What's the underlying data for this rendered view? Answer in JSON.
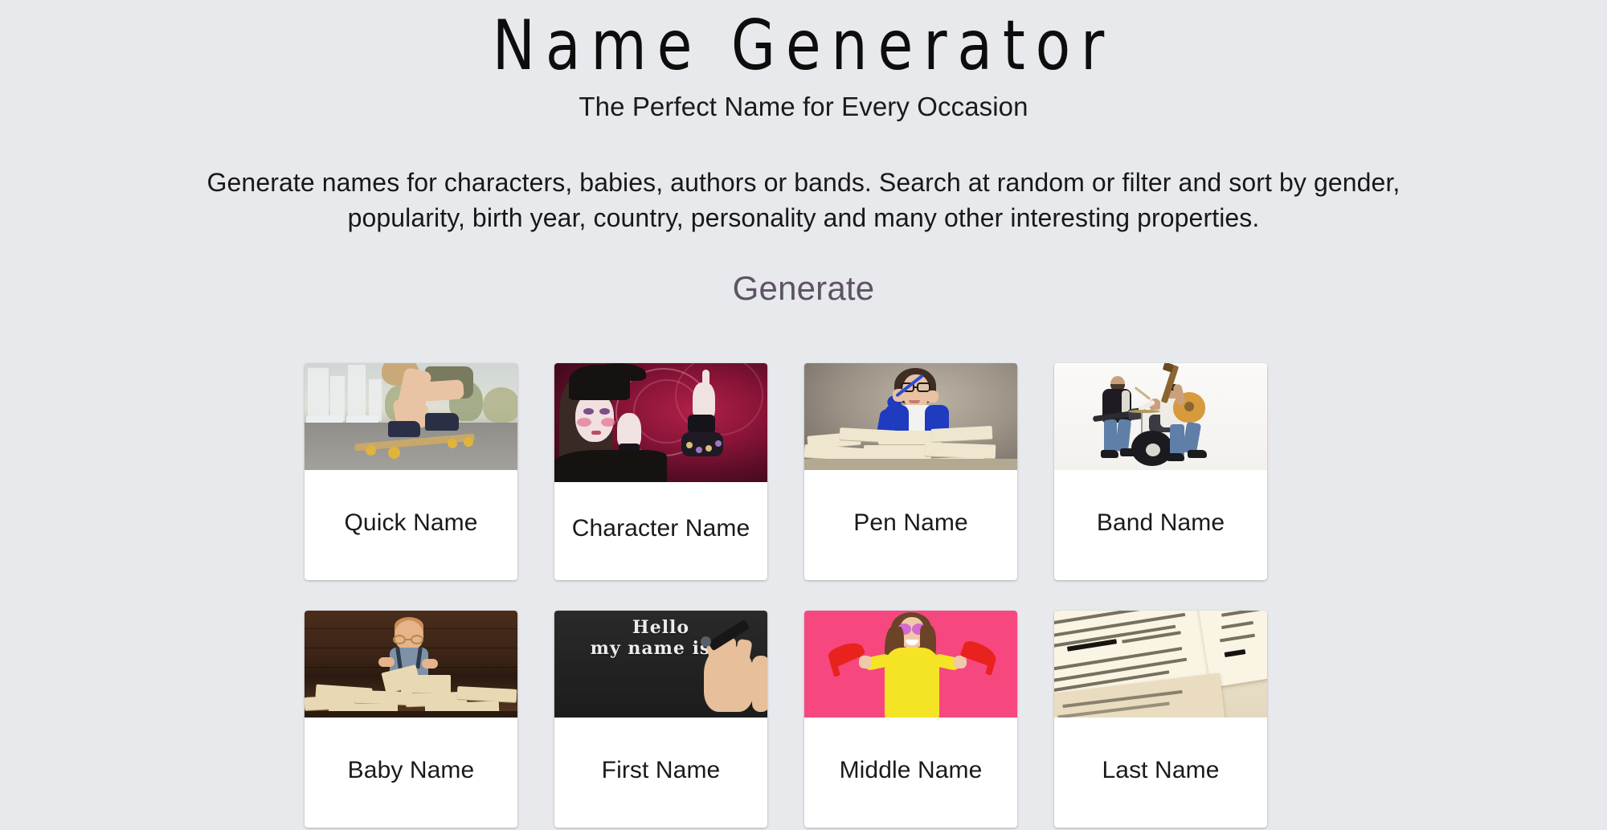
{
  "header": {
    "title": "Name Generator",
    "tagline": "The Perfect Name for Every Occasion",
    "intro": "Generate names for characters, babies, authors or bands. Search at random or filter and sort by gender, popularity, birth year, country, personality and many other interesting properties.",
    "section_heading": "Generate"
  },
  "colors": {
    "page_background": "#e7e9ed",
    "card_background": "#ffffff",
    "heading_accent": "#5d5364",
    "body_text": "#181818"
  },
  "cards": [
    {
      "id": "quick-name",
      "label": "Quick Name",
      "image_alt": "skateboarder-photo"
    },
    {
      "id": "character-name",
      "label": "Character Name",
      "image_alt": "gothic-character-photo"
    },
    {
      "id": "pen-name",
      "label": "Pen Name",
      "image_alt": "woman-with-books-photo"
    },
    {
      "id": "band-name",
      "label": "Band Name",
      "image_alt": "band-playing-photo"
    },
    {
      "id": "baby-name",
      "label": "Baby Name",
      "image_alt": "baby-reading-books-photo"
    },
    {
      "id": "first-name",
      "label": "First Name",
      "image_alt": "hello-my-name-is-chalkboard-photo"
    },
    {
      "id": "middle-name",
      "label": "Middle Name",
      "image_alt": "woman-holding-red-heels-photo"
    },
    {
      "id": "last-name",
      "label": "Last Name",
      "image_alt": "dictionary-surname-definition-photo"
    }
  ],
  "thumbnails": {
    "first_name_line1": "Hello",
    "first_name_line2": "my name is..."
  }
}
